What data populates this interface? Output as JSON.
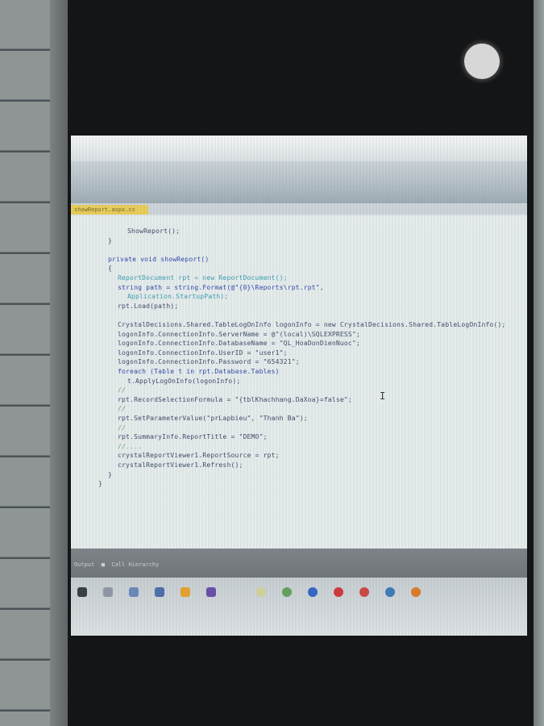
{
  "scene": {
    "description_tag": "photo-of-laptop-screen-through-phone",
    "colors": {
      "keyword": "#2e47a8",
      "string": "#b7463b",
      "type": "#3a9fae",
      "comment": "#6ca272",
      "text": "#3c4a66"
    }
  },
  "editor": {
    "tab_label": "showReport.aspx.cs",
    "caret_glyph": "I",
    "bottom_tab": "Output  ■  Call Hierarchy",
    "code_lines": [
      {
        "indent": 3,
        "text": "ShowReport();",
        "class": ""
      },
      {
        "indent": 1,
        "text": "}",
        "class": ""
      },
      {
        "indent": 1,
        "text": "",
        "class": ""
      },
      {
        "indent": 1,
        "text": "private void showReport()",
        "class": "kw"
      },
      {
        "indent": 1,
        "text": "{",
        "class": ""
      },
      {
        "indent": 2,
        "text": "ReportDocument rpt = new ReportDocument();",
        "class": "typ"
      },
      {
        "indent": 2,
        "text": "string path = string.Format(@\"{0}\\Reports\\rpt.rpt\",",
        "class": "kw"
      },
      {
        "indent": 3,
        "text": "Application.StartupPath);",
        "class": "typ"
      },
      {
        "indent": 2,
        "text": "rpt.Load(path);",
        "class": ""
      },
      {
        "indent": 1,
        "text": "",
        "class": ""
      },
      {
        "indent": 2,
        "text": "CrystalDecisions.Shared.TableLogOnInfo logonInfo = new CrystalDecisions.Shared.TableLogOnInfo();",
        "class": ""
      },
      {
        "indent": 2,
        "text": "logonInfo.ConnectionInfo.ServerName = @\"(local)\\SQLEXPRESS\";",
        "class": ""
      },
      {
        "indent": 2,
        "text": "logonInfo.ConnectionInfo.DatabaseName = \"QL_HoaDonDienNuoc\";",
        "class": ""
      },
      {
        "indent": 2,
        "text": "logonInfo.ConnectionInfo.UserID = \"user1\";",
        "class": ""
      },
      {
        "indent": 2,
        "text": "logonInfo.ConnectionInfo.Password = \"654321\";",
        "class": ""
      },
      {
        "indent": 2,
        "text": "foreach (Table t in rpt.Database.Tables)",
        "class": "kw"
      },
      {
        "indent": 3,
        "text": "t.ApplyLogOnInfo(logonInfo);",
        "class": ""
      },
      {
        "indent": 2,
        "text": "//",
        "class": "cmt"
      },
      {
        "indent": 2,
        "text": "rpt.RecordSelectionFormula = \"{tblKhachhang.DaXoa}=false\";",
        "class": ""
      },
      {
        "indent": 2,
        "text": "//",
        "class": "cmt"
      },
      {
        "indent": 2,
        "text": "rpt.SetParameterValue(\"prLapbieu\", \"Thanh Ba\");",
        "class": ""
      },
      {
        "indent": 2,
        "text": "//",
        "class": "cmt"
      },
      {
        "indent": 2,
        "text": "rpt.SummaryInfo.ReportTitle = \"DEMO\";",
        "class": ""
      },
      {
        "indent": 2,
        "text": "//....",
        "class": "cmt"
      },
      {
        "indent": 2,
        "text": "crystalReportViewer1.ReportSource = rpt;",
        "class": ""
      },
      {
        "indent": 2,
        "text": "crystalReportViewer1.Refresh();",
        "class": ""
      },
      {
        "indent": 1,
        "text": "}",
        "class": ""
      },
      {
        "indent": 0,
        "text": "}",
        "class": ""
      }
    ]
  },
  "taskbar": {
    "icons": [
      {
        "name": "start-icon",
        "color": "#3a3f46"
      },
      {
        "name": "search-icon",
        "color": "#8d97a3"
      },
      {
        "name": "task-view-icon",
        "color": "#6b87b8"
      },
      {
        "name": "file-explorer-icon",
        "color": "#4d6ea8"
      },
      {
        "name": "store-icon",
        "color": "#e1a030"
      },
      {
        "name": "vs-icon",
        "color": "#6a4fa8"
      },
      {
        "name": "chrome-icon",
        "color": "#cfcf9a"
      },
      {
        "name": "app-green-icon",
        "color": "#62a05e"
      },
      {
        "name": "app-blue-icon",
        "color": "#3466c2"
      },
      {
        "name": "opera-icon",
        "color": "#cc3b3b"
      },
      {
        "name": "app-red-icon",
        "color": "#c84848"
      },
      {
        "name": "app-square-icon",
        "color": "#3e7ab8"
      },
      {
        "name": "app-orange-icon",
        "color": "#d87a2c"
      }
    ]
  }
}
